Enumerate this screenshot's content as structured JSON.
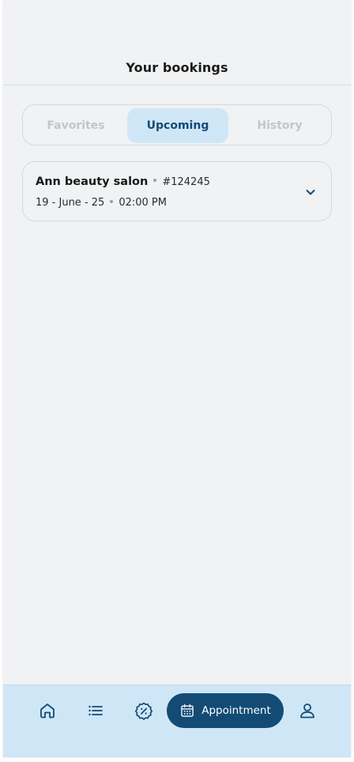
{
  "header": {
    "title": "Your bookings"
  },
  "tabs": [
    {
      "label": "Favorites",
      "active": false
    },
    {
      "label": "Upcoming",
      "active": true
    },
    {
      "label": "History",
      "active": false
    }
  ],
  "bookings": [
    {
      "name": "Ann beauty salon",
      "id": "#124245",
      "date": "19 - June - 25",
      "time": "02:00 PM"
    }
  ],
  "nav": {
    "appointment_label": "Appointment",
    "icons": [
      "home-icon",
      "list-icon",
      "discount-icon",
      "calendar-icon",
      "user-icon"
    ]
  },
  "colors": {
    "accent": "#134b75",
    "accent_light": "#cfe6f7",
    "background": "#f0f2f4",
    "muted_text": "#c2c6ca"
  }
}
